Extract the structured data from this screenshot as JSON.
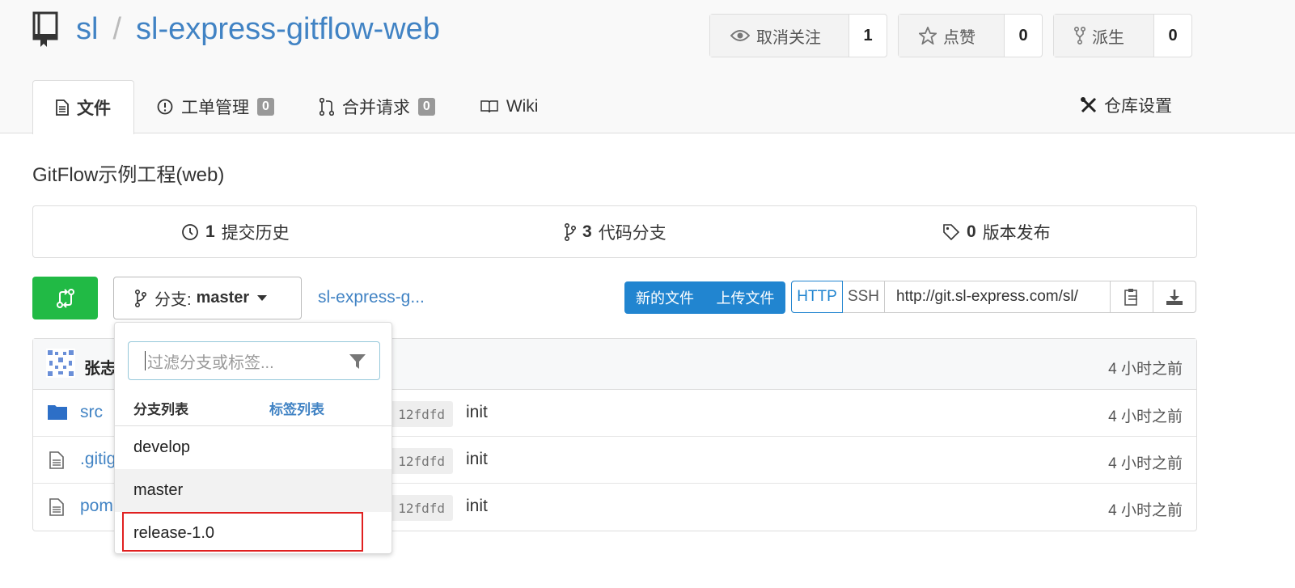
{
  "repo": {
    "owner": "sl",
    "separator": "/",
    "name": "sl-express-gitflow-web"
  },
  "header_stats": {
    "watch": {
      "label": "取消关注",
      "count": "1"
    },
    "star": {
      "label": "点赞",
      "count": "0"
    },
    "fork": {
      "label": "派生",
      "count": "0"
    }
  },
  "tabs": [
    {
      "label": "文件",
      "icon": "file-text-icon"
    },
    {
      "label": "工单管理",
      "badge": "0",
      "icon": "issue-icon"
    },
    {
      "label": "合并请求",
      "badge": "0",
      "icon": "pull-request-icon"
    },
    {
      "label": "Wiki",
      "icon": "book-open-icon"
    }
  ],
  "settings_tab": {
    "label": "仓库设置"
  },
  "description": "GitFlow示例工程(web)",
  "stats": {
    "commits": {
      "count": "1",
      "label": "提交历史"
    },
    "branches": {
      "count": "3",
      "label": "代码分支"
    },
    "releases": {
      "count": "0",
      "label": "版本发布"
    }
  },
  "branch_selector": {
    "prefix": "分支:",
    "current": "master"
  },
  "breadcrumb": "sl-express-g...",
  "actions": {
    "new_file": "新的文件",
    "upload_file": "上传文件"
  },
  "clone": {
    "http": "HTTP",
    "ssh": "SSH",
    "url": "http://git.sl-express.com/sl/"
  },
  "latest_commit": {
    "author": "张志",
    "age": "4 小时之前"
  },
  "files": [
    {
      "name": "src",
      "type": "folder",
      "sha": "12fdfd",
      "message": "init",
      "age": "4 小时之前"
    },
    {
      "name": ".gitig",
      "type": "file",
      "sha": "12fdfd",
      "message": "init",
      "age": "4 小时之前"
    },
    {
      "name": "pom",
      "type": "file",
      "sha": "12fdfd",
      "message": "init",
      "age": "4 小时之前"
    }
  ],
  "dropdown": {
    "placeholder": "过滤分支或标签...",
    "tab_branches": "分支列表",
    "tab_tags": "标签列表",
    "items": [
      "develop",
      "master",
      "release-1.0"
    ]
  },
  "colors": {
    "link": "#4183c4",
    "primary": "#2185d0",
    "success": "#21ba45",
    "highlight": "#e02020"
  }
}
